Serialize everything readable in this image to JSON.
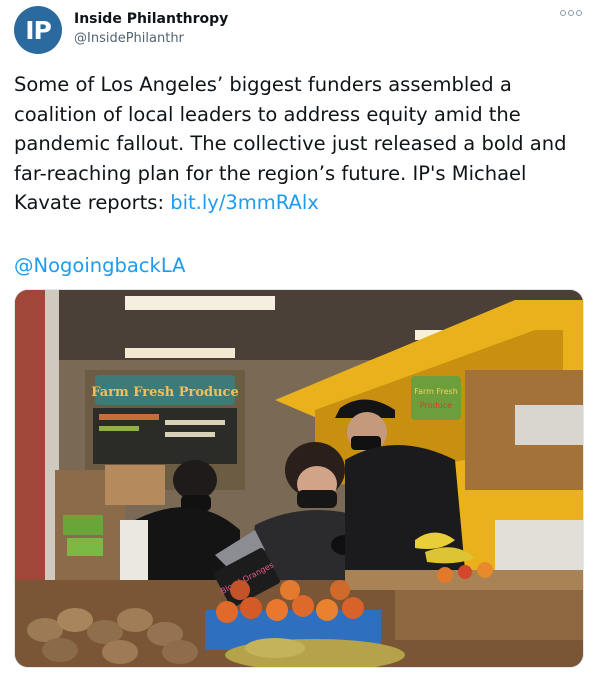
{
  "account": {
    "avatar_initials": "IP",
    "display_name": "Inside Philanthropy",
    "handle": "@InsidePhilanthr"
  },
  "icons": {
    "more": "more-options-icon",
    "avatar": "inside-philanthropy-logo"
  },
  "tweet": {
    "text_lines": [
      "Some of Los Angeles’ biggest funders assembled a",
      "coalition of local leaders to address equity amid the",
      "pandemic fallout. The collective just released a bold and",
      "far-reaching plan for the region’s future. IP's Michael",
      "Kavate reports: "
    ],
    "link": "bit.ly/3mmRAlx",
    "mention": "@NogoingbackLA"
  },
  "photo": {
    "signs": {
      "farm_fresh": "Farm Fresh Produce",
      "right_sign_1": "Farm Fresh",
      "right_sign_2": "Produce",
      "price_card": "Blood Oranges"
    }
  },
  "colors": {
    "link": "#1d9bf0",
    "text": "#0f1419",
    "secondary": "#536471",
    "avatar_bg": "#2a6a9f",
    "stall_yellow": "#e9b21c"
  }
}
